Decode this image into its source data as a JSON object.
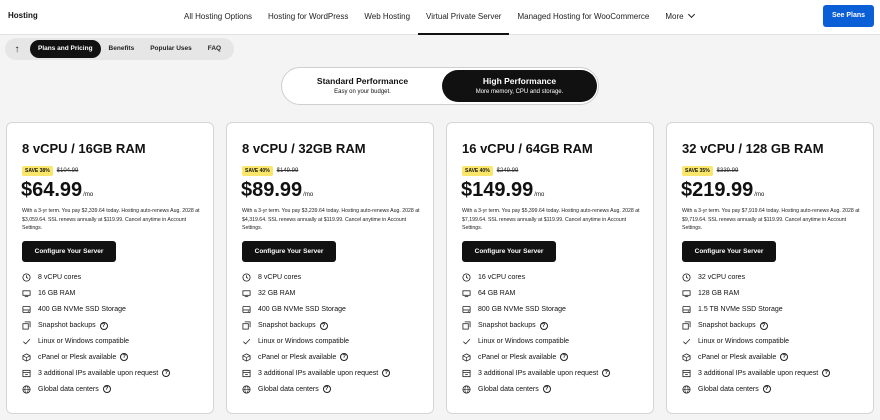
{
  "brand": "Hosting",
  "nav": {
    "links": [
      "All Hosting Options",
      "Hosting for WordPress",
      "Web Hosting",
      "Virtual Private Server",
      "Managed Hosting for WooCommerce",
      "More"
    ],
    "cta": "See Plans"
  },
  "subnav": [
    "Plans and Pricing",
    "Benefits",
    "Popular Uses",
    "FAQ"
  ],
  "toggle": {
    "standard": {
      "title": "Standard Performance",
      "subtitle": "Easy on your budget."
    },
    "high": {
      "title": "High Performance",
      "subtitle": "More memory, CPU and storage."
    }
  },
  "configure_label": "Configure Your Server",
  "per_label": "/mo",
  "plans": [
    {
      "title": "8 vCPU / 16GB RAM",
      "save": "SAVE 38%",
      "orig": "$104.99",
      "price": "$64.99",
      "terms": "With a 3-yr term. You pay $2,339.64 today. Hosting auto-renews Aug. 2028 at $3,059.64. SSL renews annually at $119.99. Cancel anytime in Account Settings.",
      "features": [
        "8 vCPU cores",
        "16 GB RAM",
        "400 GB NVMe SSD Storage",
        "Snapshot backups",
        "Linux or Windows compatible",
        "cPanel or Plesk available",
        "3 additional IPs available upon request",
        "Global data centers"
      ]
    },
    {
      "title": "8 vCPU / 32GB RAM",
      "save": "SAVE 40%",
      "orig": "$149.99",
      "price": "$89.99",
      "terms": "With a 3-yr term. You pay $3,239.64 today. Hosting auto-renews Aug. 2028 at $4,319.64. SSL renews annually at $119.99. Cancel anytime in Account Settings.",
      "features": [
        "8 vCPU cores",
        "32 GB RAM",
        "400 GB NVMe SSD Storage",
        "Snapshot backups",
        "Linux or Windows compatible",
        "cPanel or Plesk available",
        "3 additional IPs available upon request",
        "Global data centers"
      ]
    },
    {
      "title": "16 vCPU / 64GB RAM",
      "save": "SAVE 40%",
      "orig": "$249.99",
      "price": "$149.99",
      "terms": "With a 3-yr term. You pay $5,399.64 today. Hosting auto-renews Aug. 2028 at $7,199.64. SSL renews annually at $119.99. Cancel anytime in Account Settings.",
      "features": [
        "16 vCPU cores",
        "64 GB RAM",
        "800 GB NVMe SSD Storage",
        "Snapshot backups",
        "Linux or Windows compatible",
        "cPanel or Plesk available",
        "3 additional IPs available upon request",
        "Global data centers"
      ]
    },
    {
      "title": "32 vCPU / 128 GB RAM",
      "save": "SAVE 35%",
      "orig": "$339.99",
      "price": "$219.99",
      "terms": "With a 3-yr term. You pay $7,919.64 today. Hosting auto-renews Aug. 2028 at $9,719.64. SSL renews annually at $119.99. Cancel anytime in Account Settings.",
      "features": [
        "32 vCPU cores",
        "128 GB RAM",
        "1.5 TB NVMe SSD Storage",
        "Snapshot backups",
        "Linux or Windows compatible",
        "cPanel or Plesk available",
        "3 additional IPs available upon request",
        "Global data centers"
      ]
    }
  ],
  "feature_icons": [
    "cpu-icon",
    "memory-icon",
    "storage-icon",
    "backup-icon",
    "check-icon",
    "panel-icon",
    "ip-icon",
    "globe-icon"
  ],
  "feature_help": [
    false,
    false,
    false,
    true,
    false,
    true,
    true,
    true
  ]
}
